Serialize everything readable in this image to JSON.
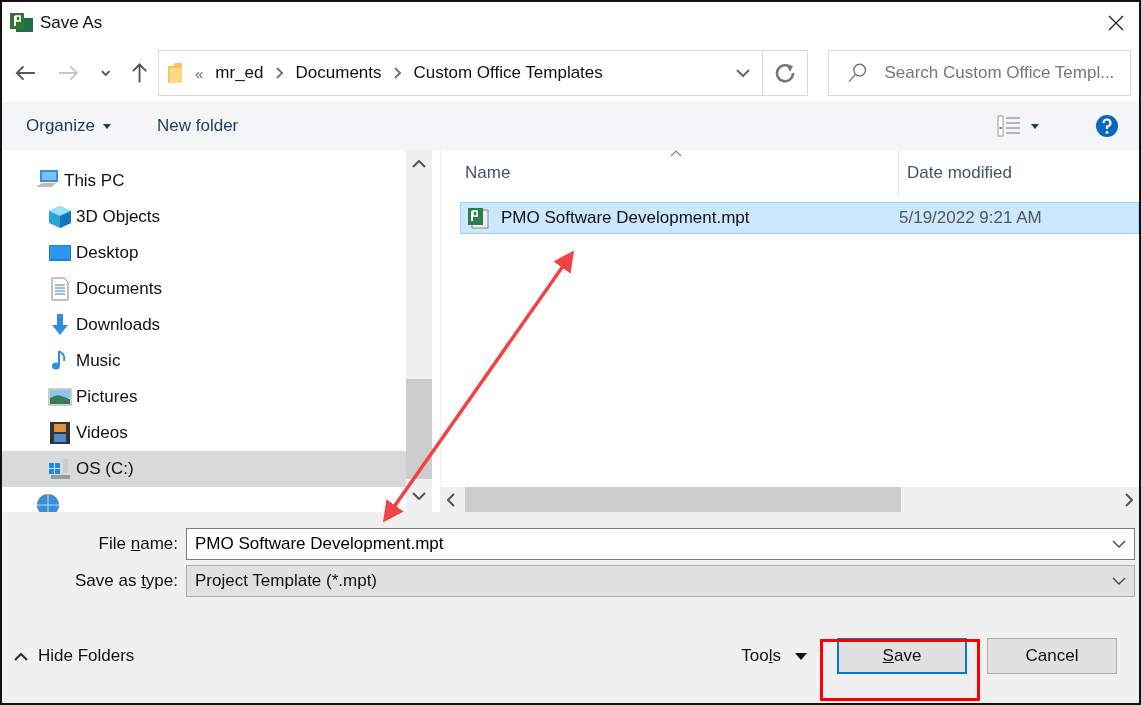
{
  "window": {
    "title": "Save As"
  },
  "navigation": {
    "back": {
      "disabled": false
    },
    "forward": {
      "disabled": true
    },
    "overflow": "«",
    "path": [
      {
        "label": "mr_ed"
      },
      {
        "label": "Documents"
      },
      {
        "label": "Custom Office Templates"
      }
    ]
  },
  "search": {
    "placeholder": "Search Custom Office Templ..."
  },
  "toolbar": {
    "organize": "Organize",
    "new_folder": "New folder"
  },
  "sidebar": {
    "items": [
      {
        "kind": "computer",
        "label": "This PC",
        "selected": false,
        "children": [
          {
            "kind": "cube",
            "label": "3D Objects",
            "selected": false
          },
          {
            "kind": "desktop",
            "label": "Desktop",
            "selected": false
          },
          {
            "kind": "document",
            "label": "Documents",
            "selected": false
          },
          {
            "kind": "download",
            "label": "Downloads",
            "selected": false
          },
          {
            "kind": "music",
            "label": "Music",
            "selected": false
          },
          {
            "kind": "pictures",
            "label": "Pictures",
            "selected": false
          },
          {
            "kind": "videos",
            "label": "Videos",
            "selected": false
          },
          {
            "kind": "drive",
            "label": "OS (C:)",
            "selected": true
          }
        ]
      },
      {
        "kind": "network",
        "selected": false
      }
    ]
  },
  "file_list": {
    "columns": [
      {
        "label": "Name",
        "sorted": true
      },
      {
        "label": "Date modified",
        "sorted": false
      }
    ],
    "rows": [
      {
        "name": "PMO Software Development.mpt",
        "date_modified": "5/19/2022 9:21 AM",
        "selected": true
      }
    ]
  },
  "form": {
    "fields": [
      {
        "kind": "text",
        "label_before": "File ",
        "access_key": "n",
        "label_after": "ame:",
        "value": "PMO Software Development.mpt"
      },
      {
        "kind": "select",
        "label_before": "Save as ",
        "access_key": "t",
        "label_after": "ype:",
        "value": "Project Template (*.mpt)"
      }
    ]
  },
  "footer": {
    "hide_folders": "Hide Folders",
    "tools": {
      "label_before": "Too",
      "access_key": "l",
      "label_after": "s"
    },
    "buttons": [
      {
        "access_key": "S",
        "label_after": "ave",
        "default": true
      },
      {
        "label_before": "Cancel",
        "default": false
      }
    ]
  },
  "annotations": [
    {
      "kind": "double-arrow",
      "color": "#ee4444"
    },
    {
      "kind": "highlight-box",
      "color": "#ff0000"
    }
  ]
}
